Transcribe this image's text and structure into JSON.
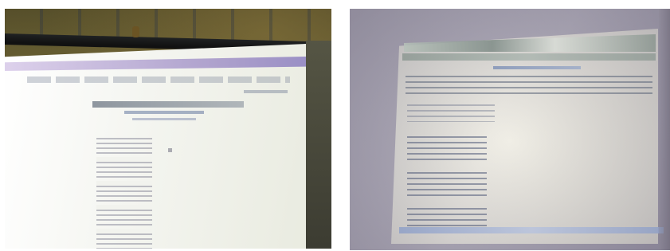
{
  "image": {
    "panels": [
      {
        "name": "left-photo",
        "subject": "projection-screen"
      },
      {
        "name": "right-photo",
        "subject": "monitor-display"
      }
    ]
  },
  "colors": {
    "left_wall": "#4a4426",
    "left_screen": "#f4f5f0",
    "left_band": "#a293c7",
    "right_background": "#b9b5c2",
    "right_screen": "#f1efe7",
    "right_banner": "#7e8b86",
    "right_bottom_bar": "#b8c3dd"
  }
}
